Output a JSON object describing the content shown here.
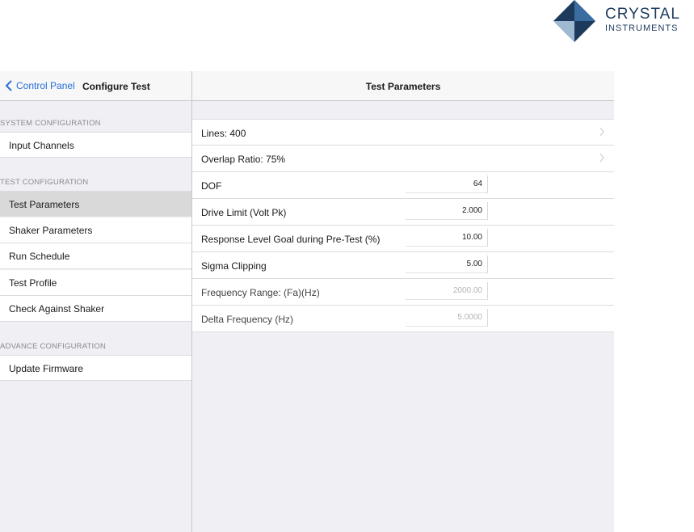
{
  "logo": {
    "line1": "CRYSTAL",
    "line2": "INSTRUMENTS"
  },
  "sidebar": {
    "back_label": "Control Panel",
    "title": "Configure Test",
    "sections": [
      {
        "header": "SYSTEM CONFIGURATION",
        "items": [
          {
            "label": "Input Channels"
          }
        ]
      },
      {
        "header": "TEST CONFIGURATION",
        "items": [
          {
            "label": "Test Parameters",
            "selected": true
          },
          {
            "label": "Shaker Parameters"
          },
          {
            "label": "Run Schedule"
          },
          {
            "label": "Test Profile"
          },
          {
            "label": "Check Against Shaker"
          }
        ]
      },
      {
        "header": "ADVANCE CONFIGURATION",
        "items": [
          {
            "label": "Update Firmware"
          }
        ]
      }
    ]
  },
  "main": {
    "title": "Test Parameters",
    "rows": [
      {
        "label": "Lines: 400",
        "type": "disclosure"
      },
      {
        "label": "Overlap Ratio: 75%",
        "type": "disclosure"
      },
      {
        "label": "DOF",
        "value": "64"
      },
      {
        "label": "Drive Limit (Volt Pk)",
        "value": "2.000"
      },
      {
        "label": "Response Level Goal during Pre-Test (%)",
        "value": "10.00"
      },
      {
        "label": "Sigma Clipping",
        "value": "5.00"
      },
      {
        "label": "Frequency Range: (Fa)(Hz)",
        "value": "2000.00",
        "disabled": true
      },
      {
        "label": "Delta Frequency (Hz)",
        "value": "5.0000",
        "disabled": true
      }
    ]
  },
  "colors": {
    "accent": "#2b6fd6",
    "selected_row": "#d9d9d9",
    "background": "#efeff4"
  }
}
